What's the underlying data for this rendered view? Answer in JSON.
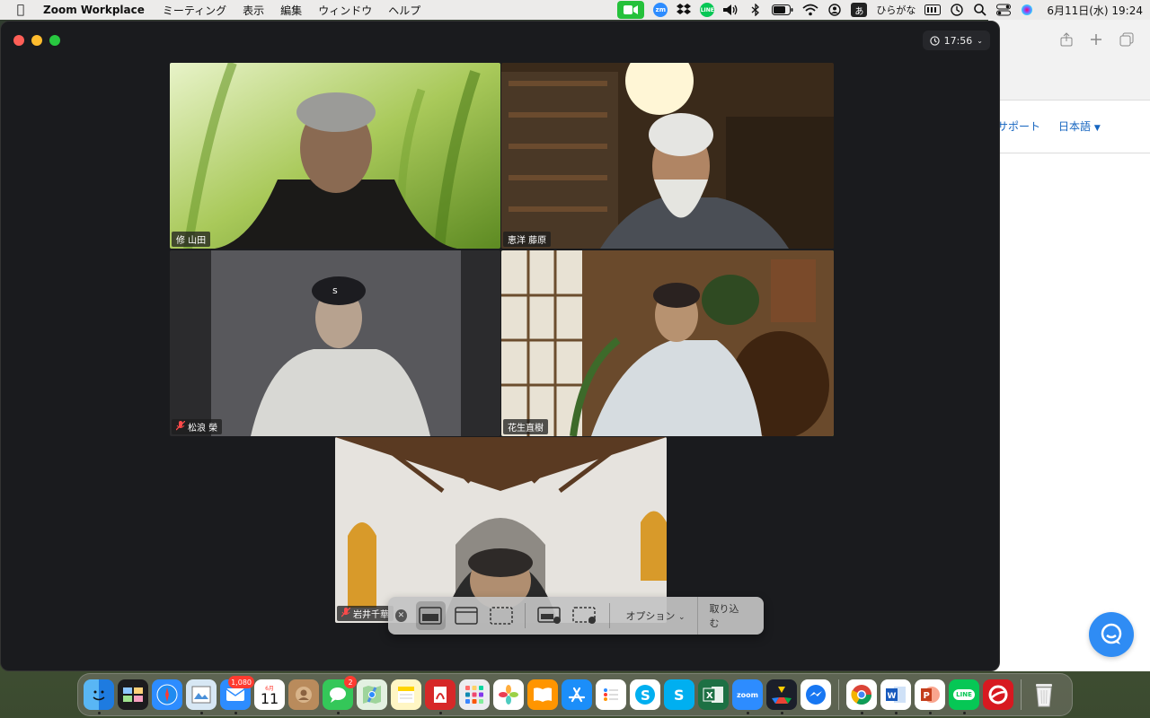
{
  "menubar": {
    "apple_icon": "apple-logo",
    "app_name": "Zoom Workplace",
    "menus": [
      "ミーティング",
      "表示",
      "編集",
      "ウィンドウ",
      "ヘルプ"
    ],
    "ime_char": "あ",
    "ime_label": "ひらがな",
    "datetime": "6月11日(水)  19:24",
    "icons": [
      "zoom-meeting-icon",
      "zoom-icon",
      "dropbox-icon",
      "line-icon",
      "volume-icon",
      "bluetooth-icon",
      "battery-icon",
      "wifi-icon",
      "user-icon",
      "input-method-icon",
      "display-icon",
      "timemachine-icon",
      "search-icon",
      "control-center-icon",
      "siri-icon"
    ]
  },
  "zoom_window": {
    "timer": "17:56",
    "participants": [
      {
        "name": "修 山田",
        "muted": false,
        "active": false
      },
      {
        "name": "恵洋 藤原",
        "muted": false,
        "active": false
      },
      {
        "name": "松浪 榮",
        "muted": true,
        "active": false
      },
      {
        "name": "花生直樹",
        "muted": false,
        "active": true
      },
      {
        "name": "岩井千華",
        "muted": true,
        "active": false
      }
    ]
  },
  "screenshot_toolbar": {
    "options_label": "オプション",
    "capture_label": "取り込む"
  },
  "browser": {
    "nav_support": "サポート",
    "nav_language": "日本語"
  },
  "dock": {
    "mail_badge": "1,080",
    "messages_badge": "2",
    "calendar_month": "6月",
    "calendar_day": "11",
    "zoom_label": "zoom",
    "line_label": "LINE",
    "word_label": "W",
    "excel_label": "X",
    "ppt_label": "P",
    "skype_label": "S"
  }
}
